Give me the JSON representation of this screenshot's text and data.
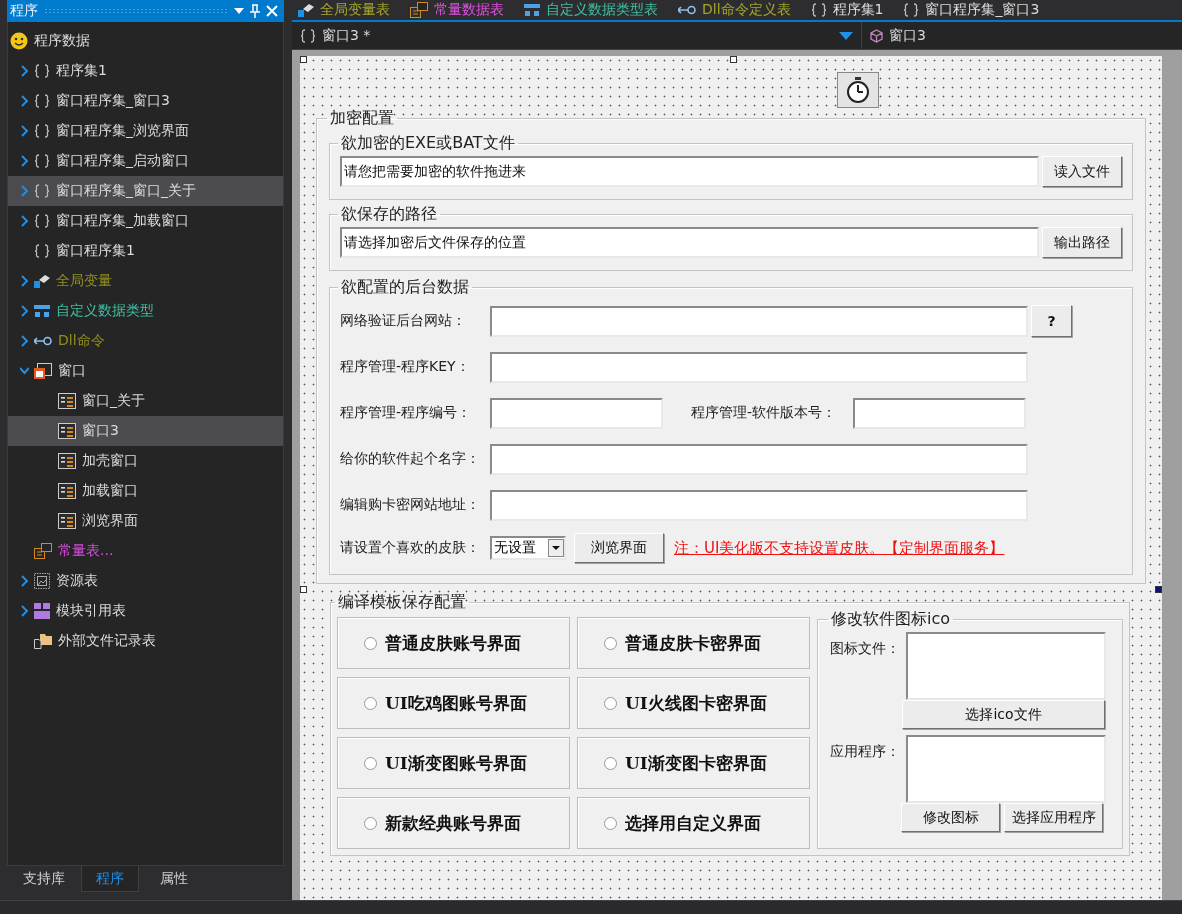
{
  "sidebar": {
    "title": "程序",
    "tree": [
      {
        "label": "程序数据",
        "kind": "root",
        "color": "#dcdcdc",
        "selected": false
      },
      {
        "label": "程序集1",
        "kind": "assembly",
        "color": "#dcdcdc",
        "expanded": false,
        "selected": false
      },
      {
        "label": "窗口程序集_窗口3",
        "kind": "assembly",
        "color": "#dcdcdc",
        "expanded": false,
        "selected": false
      },
      {
        "label": "窗口程序集_浏览界面",
        "kind": "assembly",
        "color": "#dcdcdc",
        "expanded": false,
        "selected": false
      },
      {
        "label": "窗口程序集_启动窗口",
        "kind": "assembly",
        "color": "#dcdcdc",
        "expanded": false,
        "selected": false
      },
      {
        "label": "窗口程序集_窗口_关于",
        "kind": "assembly",
        "color": "#dcdcdc",
        "expanded": false,
        "selected": true
      },
      {
        "label": "窗口程序集_加载窗口",
        "kind": "assembly",
        "color": "#dcdcdc",
        "expanded": false,
        "selected": false
      },
      {
        "label": "窗口程序集1",
        "kind": "assembly",
        "color": "#dcdcdc",
        "selected": false
      },
      {
        "label": "全局变量",
        "kind": "global",
        "color": "#8f8f1f",
        "expanded": false,
        "selected": false
      },
      {
        "label": "自定义数据类型",
        "kind": "datatype",
        "color": "#3fbfa3",
        "expanded": false,
        "selected": false
      },
      {
        "label": "Dll命令",
        "kind": "dll",
        "color": "#8f8f1f",
        "expanded": false,
        "selected": false
      },
      {
        "label": "窗口",
        "kind": "window",
        "color": "#dcdcdc",
        "expanded": true,
        "selected": false,
        "children": [
          {
            "label": "窗口_关于",
            "kind": "form",
            "color": "#dcdcdc",
            "selected": false
          },
          {
            "label": "窗口3",
            "kind": "form",
            "color": "#dcdcdc",
            "selected": true
          },
          {
            "label": "加壳窗口",
            "kind": "form",
            "color": "#dcdcdc",
            "selected": false
          },
          {
            "label": "加载窗口",
            "kind": "form",
            "color": "#dcdcdc",
            "selected": false
          },
          {
            "label": "浏览界面",
            "kind": "form",
            "color": "#dcdcdc",
            "selected": false
          }
        ]
      },
      {
        "label": "常量表...",
        "kind": "constant",
        "color": "#d14fd6",
        "selected": false
      },
      {
        "label": "资源表",
        "kind": "resource",
        "color": "#dcdcdc",
        "expanded": false,
        "selected": false
      },
      {
        "label": "模块引用表",
        "kind": "module",
        "color": "#dcdcdc",
        "expanded": false,
        "selected": false
      },
      {
        "label": "外部文件记录表",
        "kind": "external",
        "color": "#dcdcdc",
        "selected": false
      }
    ],
    "bottom_tabs": [
      {
        "label": "支持库",
        "selected": false
      },
      {
        "label": "程序",
        "selected": true
      },
      {
        "label": "属性",
        "selected": false
      }
    ]
  },
  "editor_tabs": [
    {
      "label": "全局变量表",
      "kind": "global",
      "color": "#a5a52a"
    },
    {
      "label": "常量数据表",
      "kind": "constant",
      "color": "#e050e0"
    },
    {
      "label": "自定义数据类型表",
      "kind": "datatype",
      "color": "#3fbfa3"
    },
    {
      "label": "Dll命令定义表",
      "kind": "dll",
      "color": "#a5a52a"
    },
    {
      "label": "程序集1",
      "kind": "assembly",
      "color": "#dcdcdc"
    },
    {
      "label": "窗口程序集_窗口3",
      "kind": "assembly",
      "color": "#dcdcdc"
    }
  ],
  "navigator": {
    "scope": "窗口3 *",
    "object": "窗口3"
  },
  "form": {
    "encrypt_group": {
      "title": "加密配置",
      "file_group": {
        "title": "欲加密的EXE或BAT文件",
        "value": "请您把需要加密的软件拖进来",
        "button": "读入文件"
      },
      "path_group": {
        "title": "欲保存的路径",
        "value": "请选择加密后文件保存的位置",
        "button": "输出路径"
      },
      "backend_group": {
        "title": "欲配置的后台数据",
        "site_label": "网络验证后台网站：",
        "help_button": "?",
        "key_label": "程序管理-程序KEY：",
        "number_label": "程序管理-程序编号：",
        "version_label": "程序管理-软件版本号：",
        "name_label": "给你的软件起个名字：",
        "shop_label": "编辑购卡密网站地址：",
        "skin_label": "请设置个喜欢的皮肤：",
        "skin_value": "无设置",
        "browse_button": "浏览界面",
        "note": "注：UI美化版不支持设置皮肤。【定制界面服务】"
      }
    },
    "template_group": {
      "title": "编译模板保存配置",
      "options": [
        {
          "label": "普通皮肤账号界面",
          "selected": false
        },
        {
          "label": "普通皮肤卡密界面",
          "selected": false
        },
        {
          "label": "UI吃鸡图账号界面",
          "selected": false
        },
        {
          "label": "UI火线图卡密界面",
          "selected": false
        },
        {
          "label": "UI渐变图账号界面",
          "selected": false
        },
        {
          "label": "UI渐变图卡密界面",
          "selected": false
        },
        {
          "label": "新款经典账号界面",
          "selected": false
        },
        {
          "label": "选择用自定义界面",
          "selected": false
        }
      ],
      "icon_group": {
        "title": "修改软件图标ico",
        "icon_label": "图标文件：",
        "icon_button": "选择ico文件",
        "app_label": "应用程序：",
        "modify_button": "修改图标",
        "app_button": "选择应用程序"
      }
    }
  }
}
